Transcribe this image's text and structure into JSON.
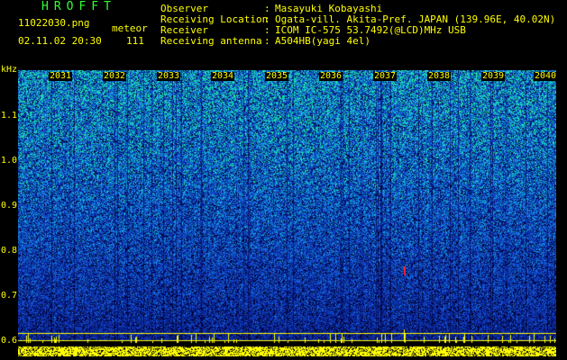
{
  "header": {
    "logo": "HROFFT",
    "filename": "11022030.png",
    "meteor_label": "meteor",
    "datetime": "02.11.02 20:30",
    "meteor_count": "111"
  },
  "metadata": [
    {
      "key": "Observer",
      "value": "Masayuki Kobayashi"
    },
    {
      "key": "Receiving Location",
      "value": "Ogata-vill. Akita-Pref. JAPAN (139.96E, 40.02N)"
    },
    {
      "key": "Receiver",
      "value": "ICOM IC-575 53.7492(@LCD)MHz USB"
    },
    {
      "key": "Receiving antenna",
      "value": "A504HB(yagi 4el)"
    }
  ],
  "axis": {
    "unit": "kHz",
    "freq_ticks": [
      "1.1",
      "1.0",
      "0.9",
      "0.8",
      "0.7",
      "0.6"
    ],
    "time_ticks": [
      "2031",
      "2032",
      "2033",
      "2034",
      "2035",
      "2036",
      "2037",
      "2038",
      "2039",
      "2040"
    ]
  },
  "colors": {
    "text": "#ffff00",
    "logo": "#33ff33",
    "baseline": "#ffff00"
  }
}
